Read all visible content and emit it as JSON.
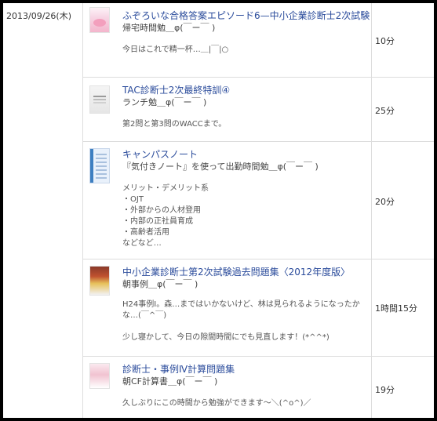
{
  "date": "2013/09/26(木)",
  "entries": [
    {
      "title": "ふぞろいな合格答案エピソード6—中小企業診断士2次試験",
      "subtitle": "帰宅時間勉＿φ(￣ー￣ )",
      "body": "今日はこれで精一杯…＿|￣|○",
      "time": "10分"
    },
    {
      "title": "TAC診断士2次最終特訓④",
      "subtitle": "ランチ勉＿φ(￣ー￣ )",
      "body": "第2問と第3問のWACCまで。",
      "time": "25分"
    },
    {
      "title": "キャンパスノート",
      "subtitle": "『気付きノート』を使って出勤時間勉＿φ(￣ー￣ )",
      "body": "メリット・デメリット系\n・OJT\n・外部からの人材登用\n・内部の正社員育成\n・高齢者活用\nなどなど…",
      "time": "20分"
    },
    {
      "title": "中小企業診断士第2次試験過去問題集〈2012年度版〉",
      "subtitle": "朝事例＿φ(￣ー￣ )",
      "body": "H24事例Ⅰ。森…まではいかないけど、林は見られるようになったかな…(￣^￣)\n\n少し寝かして、今日の隙間時間にでも見直します！(*^^*)",
      "time": "1時間15分"
    },
    {
      "title": "診断士・事例Ⅳ計算問題集",
      "subtitle": "朝CF計算書＿φ(￣ー￣ )",
      "body": "久しぶりにこの時間から勉強ができます〜＼(^o^)／",
      "time": "19分"
    }
  ]
}
